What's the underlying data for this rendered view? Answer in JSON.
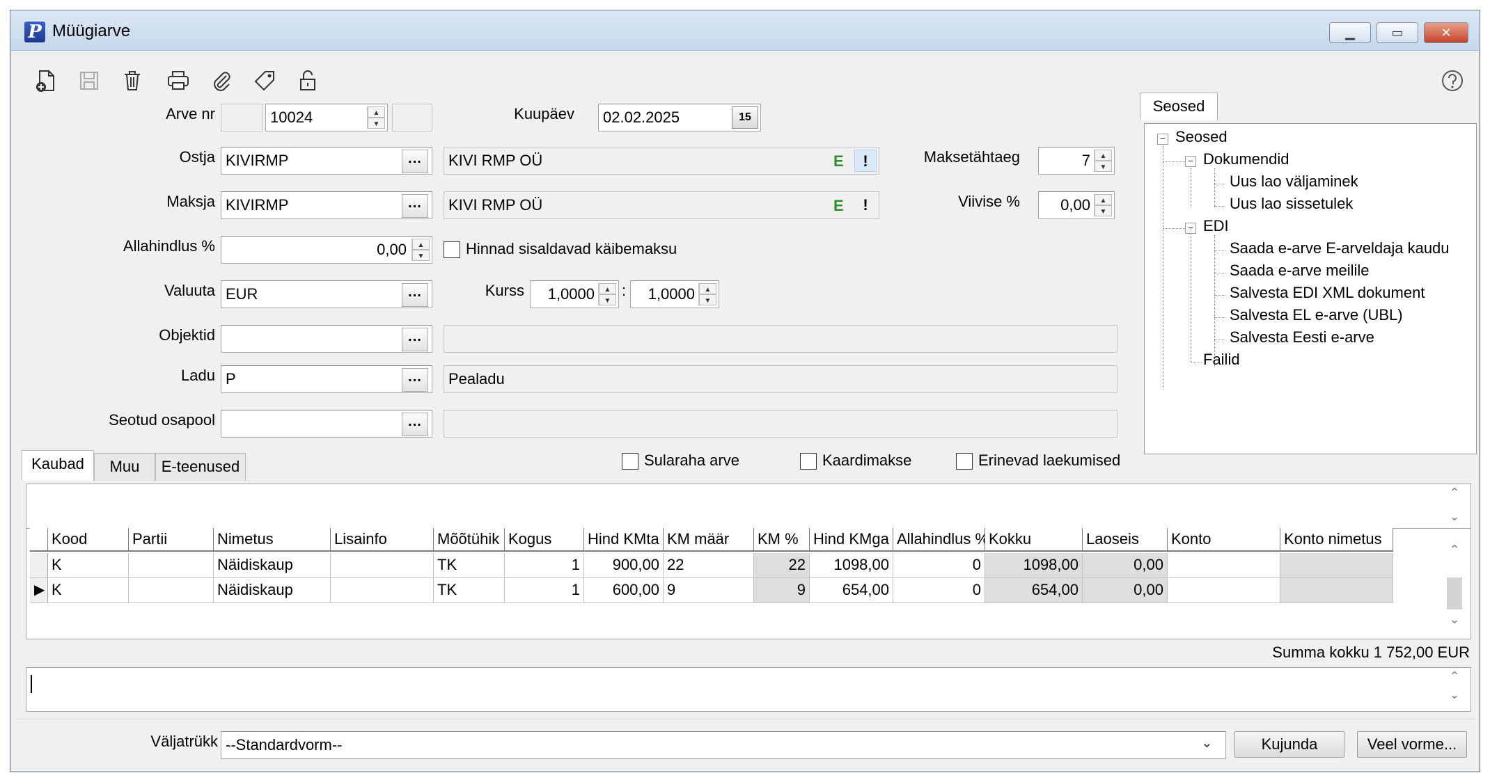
{
  "window": {
    "title": "Müügiarve"
  },
  "header_form": {
    "arve_nr_label": "Arve nr",
    "arve_nr_value": "10024",
    "kuupaev_label": "Kuupäev",
    "kuupaev_value": "02.02.2025",
    "calendar_glyph": "15",
    "ostja_label": "Ostja",
    "ostja_code": "KIVIRMP",
    "ostja_name": "KIVI RMP OÜ",
    "maksja_label": "Maksja",
    "maksja_code": "KIVIRMP",
    "maksja_name": "KIVI RMP OÜ",
    "e_flag": "E",
    "warn_flag": "!",
    "maksetahtaeg_label": "Maksetähtaeg",
    "maksetahtaeg_value": "7",
    "viivise_label": "Viivise %",
    "viivise_value": "0,00",
    "allahindlus_label": "Allahindlus %",
    "allahindlus_value": "0,00",
    "hinnad_label": "Hinnad sisaldavad käibemaksu",
    "valuuta_label": "Valuuta",
    "valuuta_value": "EUR",
    "kurss_label": "Kurss",
    "kurss_value1": "1,0000",
    "kurss_sep": ":",
    "kurss_value2": "1,0000",
    "objektid_label": "Objektid",
    "ladu_label": "Ladu",
    "ladu_code": "P",
    "ladu_name": "Pealadu",
    "seotud_label": "Seotud osapool",
    "ellipsis": "..."
  },
  "seosed": {
    "tab_label": "Seosed",
    "root": "Seosed",
    "dokumendid": "Dokumendid",
    "dok_items": [
      "Uus lao väljaminek",
      "Uus lao sissetulek"
    ],
    "edi": "EDI",
    "edi_items": [
      "Saada e-arve E-arveldaja kaudu",
      "Saada e-arve meilile",
      "Salvesta EDI XML dokument",
      "Salvesta EL e-arve (UBL)",
      "Salvesta Eesti e-arve"
    ],
    "failid": "Failid",
    "minus": "−"
  },
  "tabs": [
    "Kaubad",
    "Muu",
    "E-teenused"
  ],
  "checkboxes": {
    "sularaha": "Sularaha arve",
    "kaardimakse": "Kaardimakse",
    "erinevad": "Erinevad laekumised"
  },
  "grid": {
    "columns": [
      "Kood",
      "Partii",
      "Nimetus",
      "Lisainfo",
      "Mõõtühik",
      "Kogus",
      "Hind KMta",
      "KM määr",
      "KM %",
      "Hind KMga",
      "Allahindlus %",
      "Kokku",
      "Laoseis",
      "Konto",
      "Konto nimetus"
    ],
    "rows": [
      [
        "K",
        "",
        "Näidiskaup",
        "",
        "TK",
        "1",
        "900,00",
        "22",
        "22",
        "1098,00",
        "0",
        "1098,00",
        "0,00",
        "",
        ""
      ],
      [
        "K",
        "",
        "Näidiskaup",
        "",
        "TK",
        "1",
        "600,00",
        "9",
        "9",
        "654,00",
        "0",
        "654,00",
        "0,00",
        "",
        ""
      ]
    ]
  },
  "summa": "Summa kokku 1 752,00 EUR",
  "footer": {
    "valjatrukk_label": "Väljatrükk",
    "valjatrukk_value": "--Standardvorm--",
    "kujunda": "Kujunda",
    "veel_vorme": "Veel vorme..."
  },
  "scroll": {
    "up": "⌃",
    "down": "⌄"
  },
  "toolbar_icons": [
    "new-document-icon",
    "save-icon",
    "delete-icon",
    "print-icon",
    "attach-icon",
    "tag-icon",
    "unlock-icon",
    "help-icon"
  ]
}
